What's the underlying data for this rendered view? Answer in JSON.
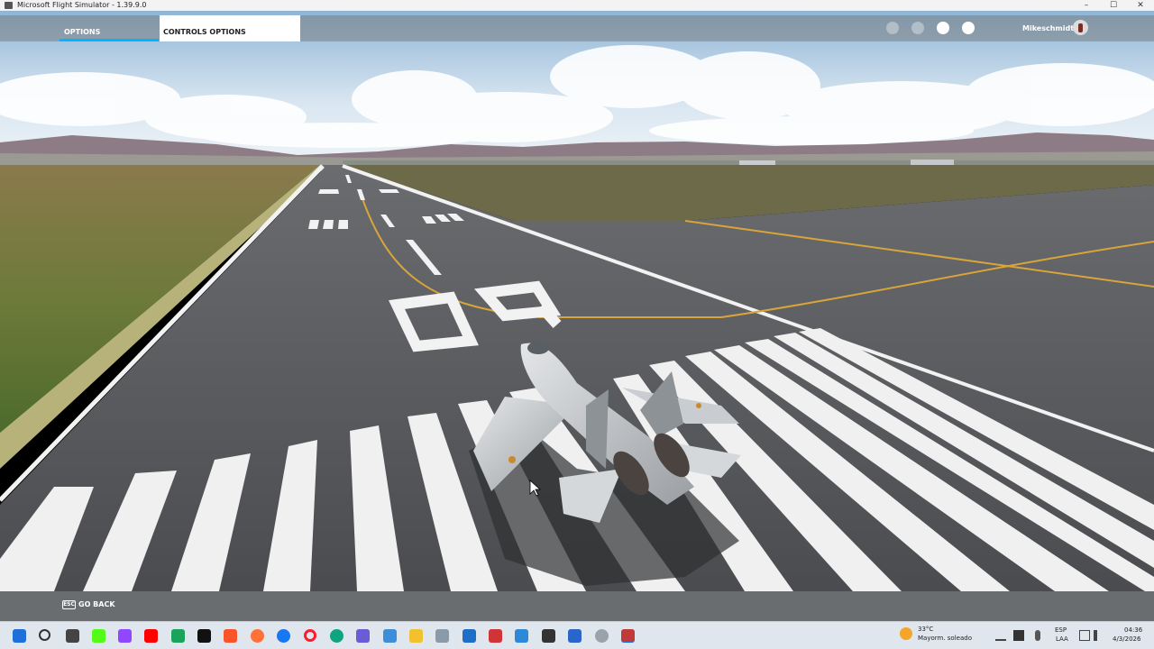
{
  "window": {
    "title": "Microsoft Flight Simulator - 1.39.9.0",
    "minimize": "–",
    "maximize": "☐",
    "close": "✕"
  },
  "nav": {
    "tabs": [
      {
        "label": "OPTIONS",
        "active": true
      },
      {
        "label": "CONTROLS OPTIONS",
        "active": false
      }
    ],
    "icons": [
      "sync-icon",
      "achievements-icon",
      "profile-icon",
      "notifications-icon"
    ],
    "username": "MikeschmidtX"
  },
  "scene": {
    "runway_number": "09"
  },
  "footer": {
    "esc_key": "ESC",
    "go_back": "GO BACK"
  },
  "taskbar": {
    "apps": [
      "start-icon",
      "search-icon",
      "task-view-icon",
      "k-app-icon",
      "twitch-icon",
      "youtube-icon",
      "green-app-icon",
      "x-icon",
      "brave-icon",
      "firefox-icon",
      "facebook-icon",
      "opera-icon",
      "edge-icon",
      "photos-icon",
      "pc-app-icon",
      "file-explorer-icon",
      "store-icon",
      "mail-icon",
      "calendar-app-icon",
      "photos-app-icon",
      "ea-icon",
      "snipping-icon",
      "chrome-icon",
      "flight-sim-icon"
    ],
    "weather": {
      "temp": "33°C",
      "desc": "Mayorm. soleado"
    },
    "lang": {
      "line1": "ESP",
      "line2": "LAA"
    },
    "clock": {
      "time": "04:36",
      "date": "4/3/2026"
    }
  },
  "colors": {
    "accent": "#00b4ff",
    "runway": "#55575a",
    "taxi_line": "#d8a53a"
  }
}
